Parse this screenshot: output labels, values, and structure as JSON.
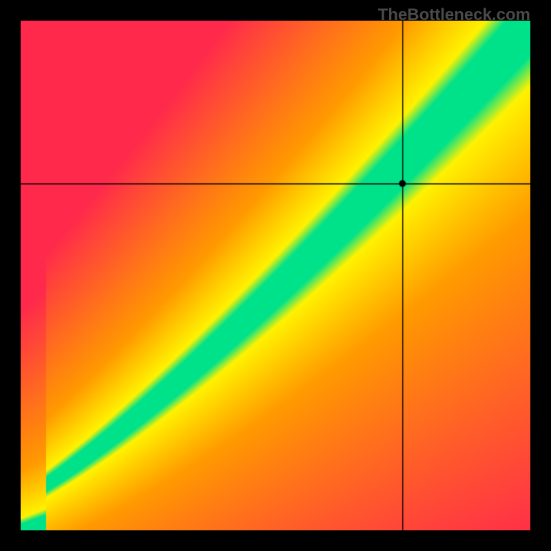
{
  "watermark": "TheBottleneck.com",
  "chart_data": {
    "type": "heatmap",
    "title": "",
    "xlabel": "",
    "ylabel": "",
    "xlim": [
      0,
      100
    ],
    "ylim": [
      0,
      100
    ],
    "crosshair": {
      "x": 75,
      "y": 68
    },
    "marker": {
      "x": 75,
      "y": 68
    },
    "optimal_curve_description": "Diagonal curved band from bottom-left to top-right representing balanced performance; green = optimal, yellow = marginal, red = bottlenecked",
    "colors": {
      "optimal": "#00e28a",
      "marginal": "#fff200",
      "orange": "#ff9a00",
      "bottleneck": "#ff2a4b"
    }
  }
}
